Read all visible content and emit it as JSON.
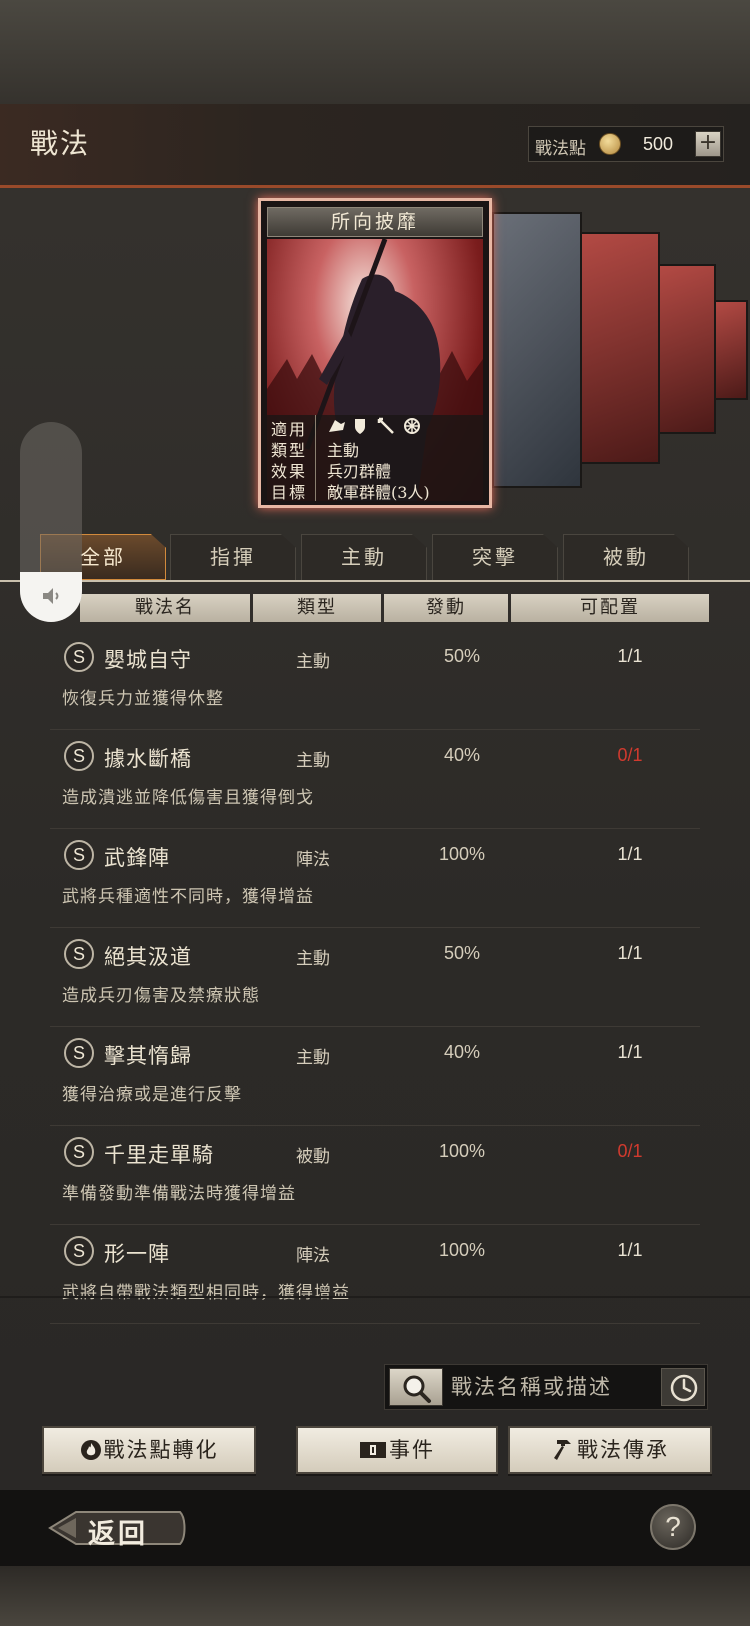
{
  "header": {
    "title": "戰法",
    "points_label": "戰法點",
    "points_value": "500",
    "add_label": "+"
  },
  "card": {
    "name": "所向披靡",
    "info": [
      {
        "key": "適用",
        "value": ""
      },
      {
        "key": "類型",
        "value": "主動"
      },
      {
        "key": "效果",
        "value": "兵刃群體"
      },
      {
        "key": "目標",
        "value": "敵軍群體(3人)"
      }
    ]
  },
  "volume": {
    "level": 0.25
  },
  "tabs": [
    {
      "label": "全部",
      "active": true
    },
    {
      "label": "指揮"
    },
    {
      "label": "主動"
    },
    {
      "label": "突擊"
    },
    {
      "label": "被動"
    }
  ],
  "columns": [
    "戰法名",
    "類型",
    "發動",
    "可配置"
  ],
  "tactics": [
    {
      "grade": "S",
      "name": "嬰城自守",
      "type": "主動",
      "rate": "50%",
      "count": "1/1",
      "count_red": false,
      "desc": "恢復兵力並獲得休整"
    },
    {
      "grade": "S",
      "name": "據水斷橋",
      "type": "主動",
      "rate": "40%",
      "count": "0/1",
      "count_red": true,
      "desc": "造成潰逃並降低傷害且獲得倒戈"
    },
    {
      "grade": "S",
      "name": "武鋒陣",
      "type": "陣法",
      "rate": "100%",
      "count": "1/1",
      "count_red": false,
      "desc": "武將兵種適性不同時，獲得增益"
    },
    {
      "grade": "S",
      "name": "絕其汲道",
      "type": "主動",
      "rate": "50%",
      "count": "1/1",
      "count_red": false,
      "desc": "造成兵刃傷害及禁療狀態"
    },
    {
      "grade": "S",
      "name": "擊其惰歸",
      "type": "主動",
      "rate": "40%",
      "count": "1/1",
      "count_red": false,
      "desc": "獲得治療或是進行反擊"
    },
    {
      "grade": "S",
      "name": "千里走單騎",
      "type": "被動",
      "rate": "100%",
      "count": "0/1",
      "count_red": true,
      "desc": "準備發動準備戰法時獲得增益"
    },
    {
      "grade": "S",
      "name": "形一陣",
      "type": "陣法",
      "rate": "100%",
      "count": "1/1",
      "count_red": false,
      "desc": "武將自帶戰法類型相同時，獲得增益"
    }
  ],
  "search": {
    "placeholder": "戰法名稱或描述"
  },
  "actions": {
    "convert": "戰法點轉化",
    "event": "事件",
    "inherit": "戰法傳承"
  },
  "footer": {
    "back": "返回",
    "help": "?"
  },
  "colors": {
    "accent": "#d28a3c",
    "warning_red": "#d03a2e",
    "card_glow": "#e36c5a"
  }
}
